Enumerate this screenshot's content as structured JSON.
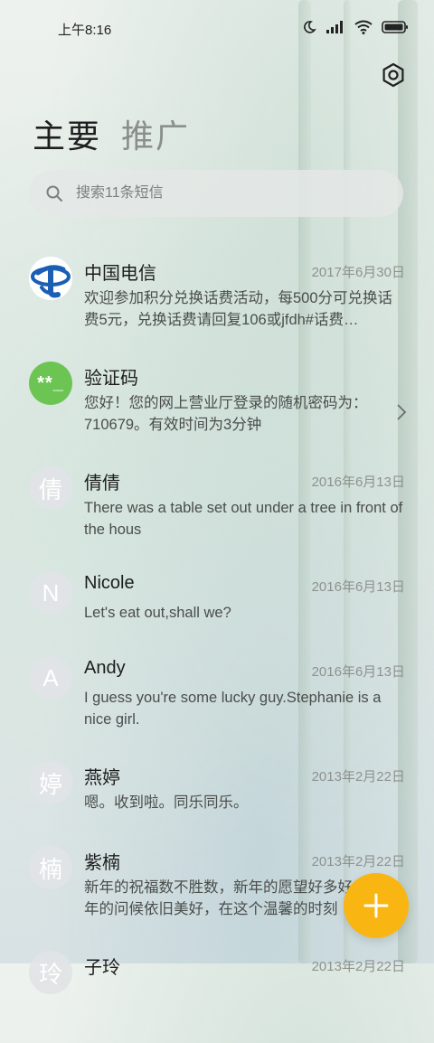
{
  "status_bar": {
    "time": "上午8:16"
  },
  "tabs": [
    {
      "label": "主要"
    },
    {
      "label": "推广"
    }
  ],
  "search": {
    "placeholder": "搜索11条短信"
  },
  "messages": [
    {
      "name": "中国电信",
      "date": "2017年6月30日",
      "snippet": "欢迎参加积分兑换话费活动，每500分可兑换话费5元，兑换话费请回复106或jfdh#话费…",
      "avatar": "telecom-logo"
    },
    {
      "name": "验证码",
      "date": "",
      "snippet": "您好！您的网上营业厅登录的随机密码为：710679。有效时间为3分钟",
      "avatar": "**_"
    },
    {
      "name": "倩倩",
      "date": "2016年6月13日",
      "snippet": "There was a table set out under a tree in front of the hous",
      "avatar": "倩"
    },
    {
      "name": "Nicole",
      "date": "2016年6月13日",
      "snippet": "Let's eat out,shall we?",
      "avatar": "N"
    },
    {
      "name": "Andy",
      "date": "2016年6月13日",
      "snippet": "I guess you're some lucky guy.Stephanie is a nice girl.",
      "avatar": "A"
    },
    {
      "name": "燕婷",
      "date": "2013年2月22日",
      "snippet": "嗯。收到啦。同乐同乐。",
      "avatar": "婷"
    },
    {
      "name": "紫楠",
      "date": "2013年2月22日",
      "snippet": "新年的祝福数不胜数，新年的愿望好多好多，新年的问候依旧美好，在这个温馨的时刻",
      "avatar": "楠"
    },
    {
      "name": "子玲",
      "date": "2013年2月22日",
      "snippet": "",
      "avatar": "玲"
    }
  ],
  "colors": {
    "accent": "#f9b512",
    "verify_avatar": "#6cc552",
    "telecom_blue": "#1a5fb4"
  }
}
